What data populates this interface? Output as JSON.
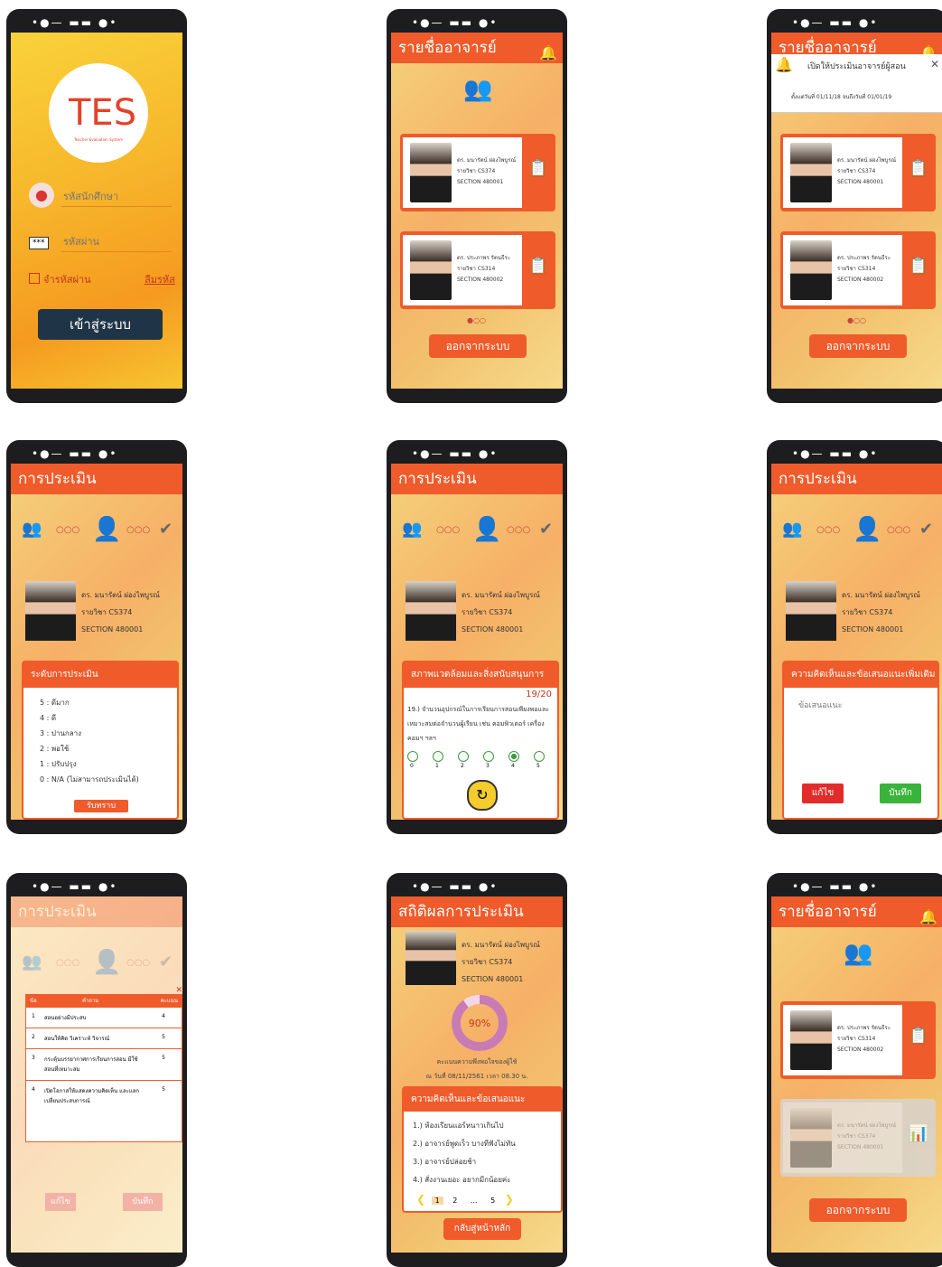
{
  "login": {
    "logo_text": "TES",
    "logo_sub": "Teacher Evaluation System",
    "student_id_placeholder": "รหัสนักศึกษา",
    "password_placeholder": "รหัสผ่าน",
    "remember": "จำรหัสผ่าน",
    "forgot": "ลืมรหัส",
    "login_button": "เข้าสู่ระบบ"
  },
  "teacher_list": {
    "title": "รายชื่ออาจารย์",
    "logout": "ออกจากระบบ",
    "teachers": [
      {
        "line1": "ดร. มนารัตน์ ผ่องไพบูรณ์",
        "line2": "รายวิชา CS374",
        "line3": "SECTION 480001"
      },
      {
        "line1": "ดร. ประภาพร รัตนธีระ",
        "line2": "รายวิชา CS314",
        "line3": "SECTION 480002"
      }
    ]
  },
  "notify": {
    "title": "เปิดให้ประเมินอาจารย์ผู้สอน",
    "period": "ตั้งแต่วันที่ 01/11/18 จนถึงวันที่ 01/01/19"
  },
  "evaluation": {
    "title": "การประเมิน",
    "name": "ดร. มนารัตน์ ผ่องไพบูรณ์",
    "course": "รายวิชา CS374",
    "section": "SECTION 480001",
    "levels_title": "ระดับการประเมิน",
    "levels": [
      "5 : ดีมาก",
      "4 : ดี",
      "3 : ปานกลาง",
      "2 : พอใช้",
      "1 : ปรับปรุง",
      "0 : N/A (ไม่สามารถประเมินได้)"
    ],
    "ack": "รับทราบ",
    "question_title": "สภาพแวดล้อมและสิ่งสนับสนุนการเรียนรู้",
    "progress": "19/20",
    "question": "19.) จำนวนอุปกรณ์ในการเรียนการสอนเพียงพอและเหมาะสมต่อจำนวนผู้เรียน เช่น คอมพิวเตอร์ เครื่องคอมฯ ฯลฯ",
    "scale": [
      "0",
      "1",
      "2",
      "3",
      "4",
      "5"
    ],
    "selected": "4",
    "comment_title": "ความคิดเห็นและข้อเสนอแนะเพิ่มเติม",
    "comment_placeholder": "ข้อเสนอแนะ",
    "edit": "แก้ไข",
    "save": "บันทึก"
  },
  "summary_table": {
    "headers": [
      "ข้อ",
      "คำถาม",
      "คะแนน"
    ],
    "rows": [
      [
        "1",
        "สอนอย่างมีประสบ",
        "4"
      ],
      [
        "2",
        "สอนให้คิด วิเคราะห์ วิจารณ์",
        "5"
      ],
      [
        "3",
        "กระตุ้นบรรยากาศการเรียนการสอน มีใช้สอนที่เหมาะสม",
        "5"
      ],
      [
        "4",
        "เปิดโอกาสให้แสดงความคิดเห็น และแลกเปลี่ยนประสบการณ์",
        "5"
      ]
    ]
  },
  "stats": {
    "title": "สถิติผลการประเมิน",
    "percent": "90%",
    "percent_value": 0.9,
    "caption": "คะแนนความพึงพอใจของผู้ใช้",
    "date": "ณ วันที่ 08/11/2561 เวลา 08.30 น.",
    "comments_title": "ความคิดเห็นและข้อเสนอแนะ",
    "comments": [
      "1.) ห้องเรียนแอร์หนาวเกินไป",
      "2.) อาจารย์พูดเร็ว บางทีฟังไม่ทัน",
      "3.) อาจารย์ปล่อยช้า",
      "4.) สั่งงานเยอะ อยากมีกน้อยค่ะ"
    ],
    "pages": [
      "1",
      "2",
      "...",
      "5"
    ],
    "back": "กลับสู่หน้าหลัก"
  }
}
